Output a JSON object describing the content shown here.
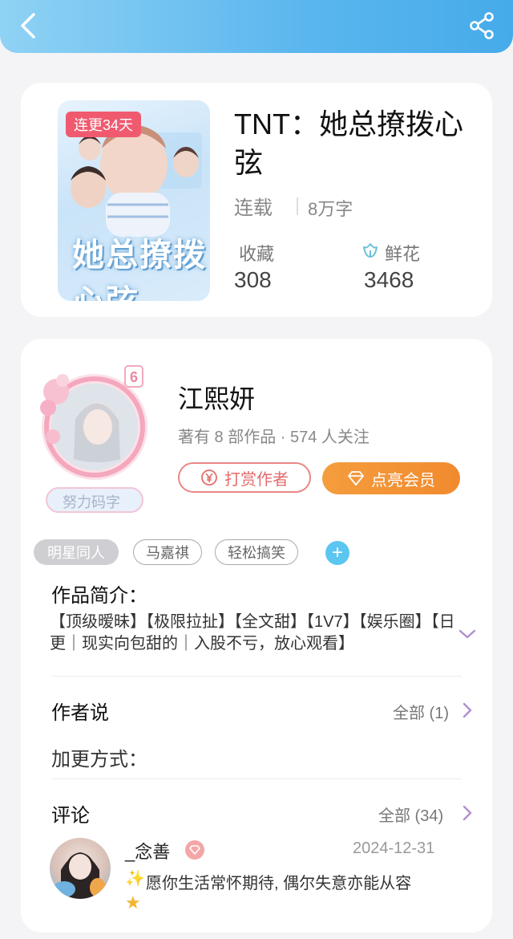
{
  "book": {
    "cover_badge": "连更34天",
    "cover_title": "她总撩拨心弦",
    "title": "TNT：她总撩拨心弦",
    "status": "连载",
    "words": "8万字",
    "favorites_label": "收藏",
    "favorites_value": "308",
    "flowers_label": "鲜花",
    "flowers_value": "3468"
  },
  "author": {
    "level": "6",
    "name": "江熙妍",
    "meta": "著有 8 部作品 · 574 人关注",
    "motto": "努力码字",
    "tip_label": "打赏作者",
    "vip_label": "点亮会员"
  },
  "tags": [
    "明星同人",
    "马嘉祺",
    "轻松搞笑"
  ],
  "intro": {
    "title": "作品简介：",
    "text": "【顶级暧昧】【极限拉扯】【全文甜】【1V7】【娱乐圈】【日更｜现实向包甜的｜入股不亏，放心观看】"
  },
  "author_says": {
    "title": "作者说",
    "more": "全部 (1)",
    "content": "加更方式："
  },
  "comments": {
    "title": "评论",
    "more": "全部 (34)",
    "items": [
      {
        "name": "_念善",
        "date": "2024-12-31",
        "text": "愿你生活常怀期待, 偶尔失意亦能从容"
      }
    ]
  },
  "colors": {
    "header_start": "#8fd2f4",
    "header_end": "#46abea",
    "badge_red": "#ef5a6f",
    "vip_orange": "#f18a2e",
    "accent_blue": "#5bc6f0"
  }
}
